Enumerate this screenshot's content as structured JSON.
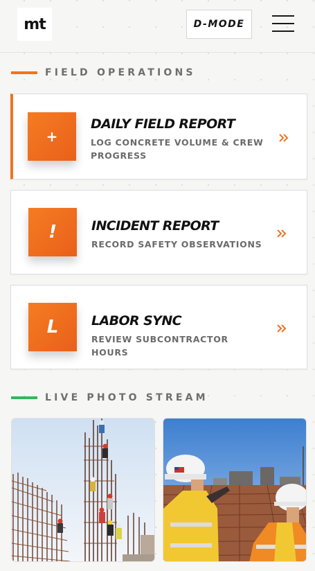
{
  "header": {
    "logo": "mt",
    "mode_button": "D-MODE",
    "menu_icon": "hamburger-menu-icon"
  },
  "field_operations": {
    "title": "FIELD OPERATIONS",
    "accent": "#f07320",
    "cards": [
      {
        "icon": "+",
        "title": "DAILY FIELD REPORT",
        "subtitle": "LOG CONCRETE VOLUME & CREW PROGRESS",
        "action_icon": "double-chevron-right-icon"
      },
      {
        "icon": "!",
        "title": "INCIDENT REPORT",
        "subtitle": "RECORD SAFETY OBSERVATIONS",
        "action_icon": "double-chevron-right-icon"
      },
      {
        "icon": "L",
        "title": "LABOR SYNC",
        "subtitle": "REVIEW SUBCONTRACTOR HOURS",
        "action_icon": "double-chevron-right-icon"
      }
    ]
  },
  "live_photo_stream": {
    "title": "LIVE PHOTO STREAM",
    "accent": "#2dbb5a",
    "photos": [
      {
        "subject": "workers climbing rebar cages"
      },
      {
        "subject": "engineers in hard hats and safety vests on site"
      }
    ]
  }
}
